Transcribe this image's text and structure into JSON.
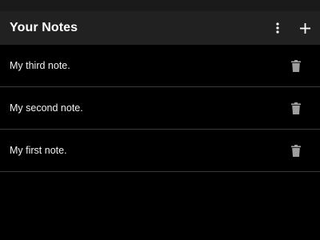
{
  "app_bar": {
    "title": "Your Notes",
    "menu_icon": "more-vert-icon",
    "add_icon": "add-icon"
  },
  "notes": [
    {
      "text": "My third note.",
      "delete_icon": "trash-icon"
    },
    {
      "text": "My second note.",
      "delete_icon": "trash-icon"
    },
    {
      "text": "My first note.",
      "delete_icon": "trash-icon"
    }
  ],
  "colors": {
    "background": "#000000",
    "app_bar": "#212121",
    "status_bar": "#1a1a1a",
    "text": "#ffffff",
    "icon_muted": "#9e9e9e",
    "divider": "#3a3a3a"
  }
}
